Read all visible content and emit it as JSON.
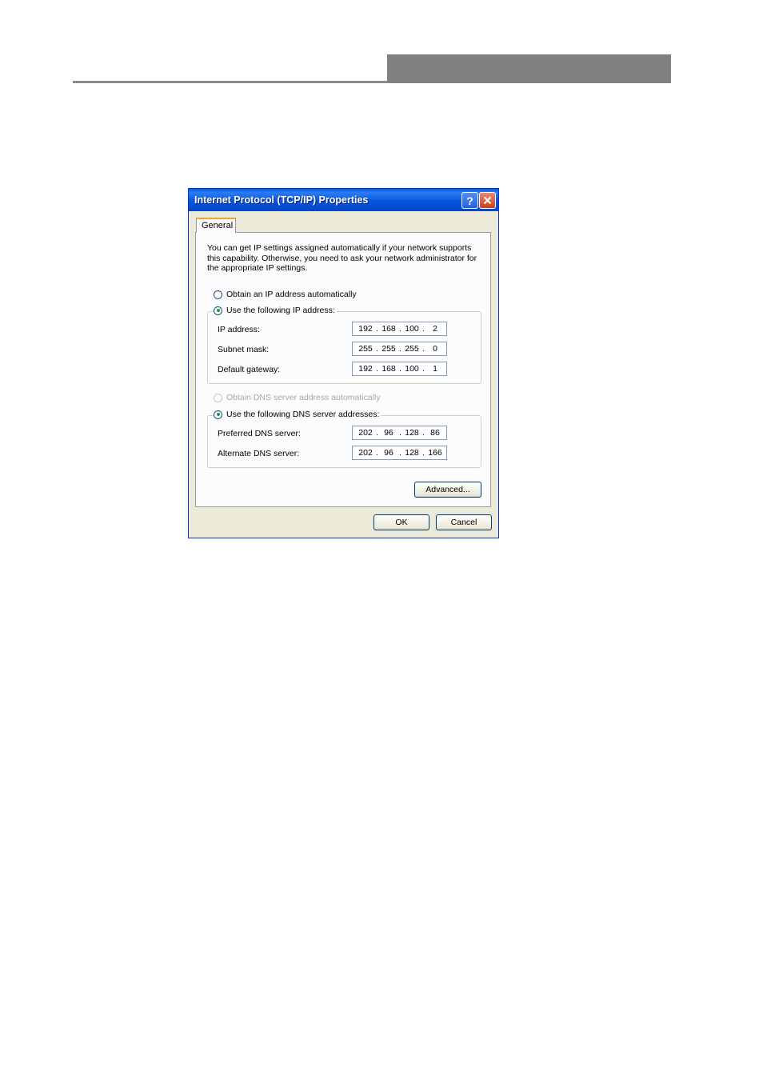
{
  "dialog": {
    "title": "Internet Protocol (TCP/IP) Properties",
    "help_glyph": "?",
    "tab_general": "General",
    "intro": "You can get IP settings assigned automatically if your network supports this capability. Otherwise, you need to ask your network administrator for the appropriate IP settings.",
    "radio_ip_auto": "Obtain an IP address automatically",
    "radio_ip_manual": "Use the following IP address:",
    "ip_label": "IP address:",
    "ip": [
      "192",
      "168",
      "100",
      "2"
    ],
    "subnet_label": "Subnet mask:",
    "subnet": [
      "255",
      "255",
      "255",
      "0"
    ],
    "gateway_label": "Default gateway:",
    "gateway": [
      "192",
      "168",
      "100",
      "1"
    ],
    "radio_dns_auto": "Obtain DNS server address automatically",
    "radio_dns_manual": "Use the following DNS server addresses:",
    "pref_dns_label": "Preferred DNS server:",
    "pref_dns": [
      "202",
      "96",
      "128",
      "86"
    ],
    "alt_dns_label": "Alternate DNS server:",
    "alt_dns": [
      "202",
      "96",
      "128",
      "166"
    ],
    "advanced_label": "Advanced...",
    "ok_label": "OK",
    "cancel_label": "Cancel"
  },
  "colors": {
    "titlebar": "#0855dd",
    "dialog_bg": "#ece9d8",
    "tab_highlight": "#f5a22e",
    "radio_dot": "#21a121",
    "header_block": "#808080"
  }
}
